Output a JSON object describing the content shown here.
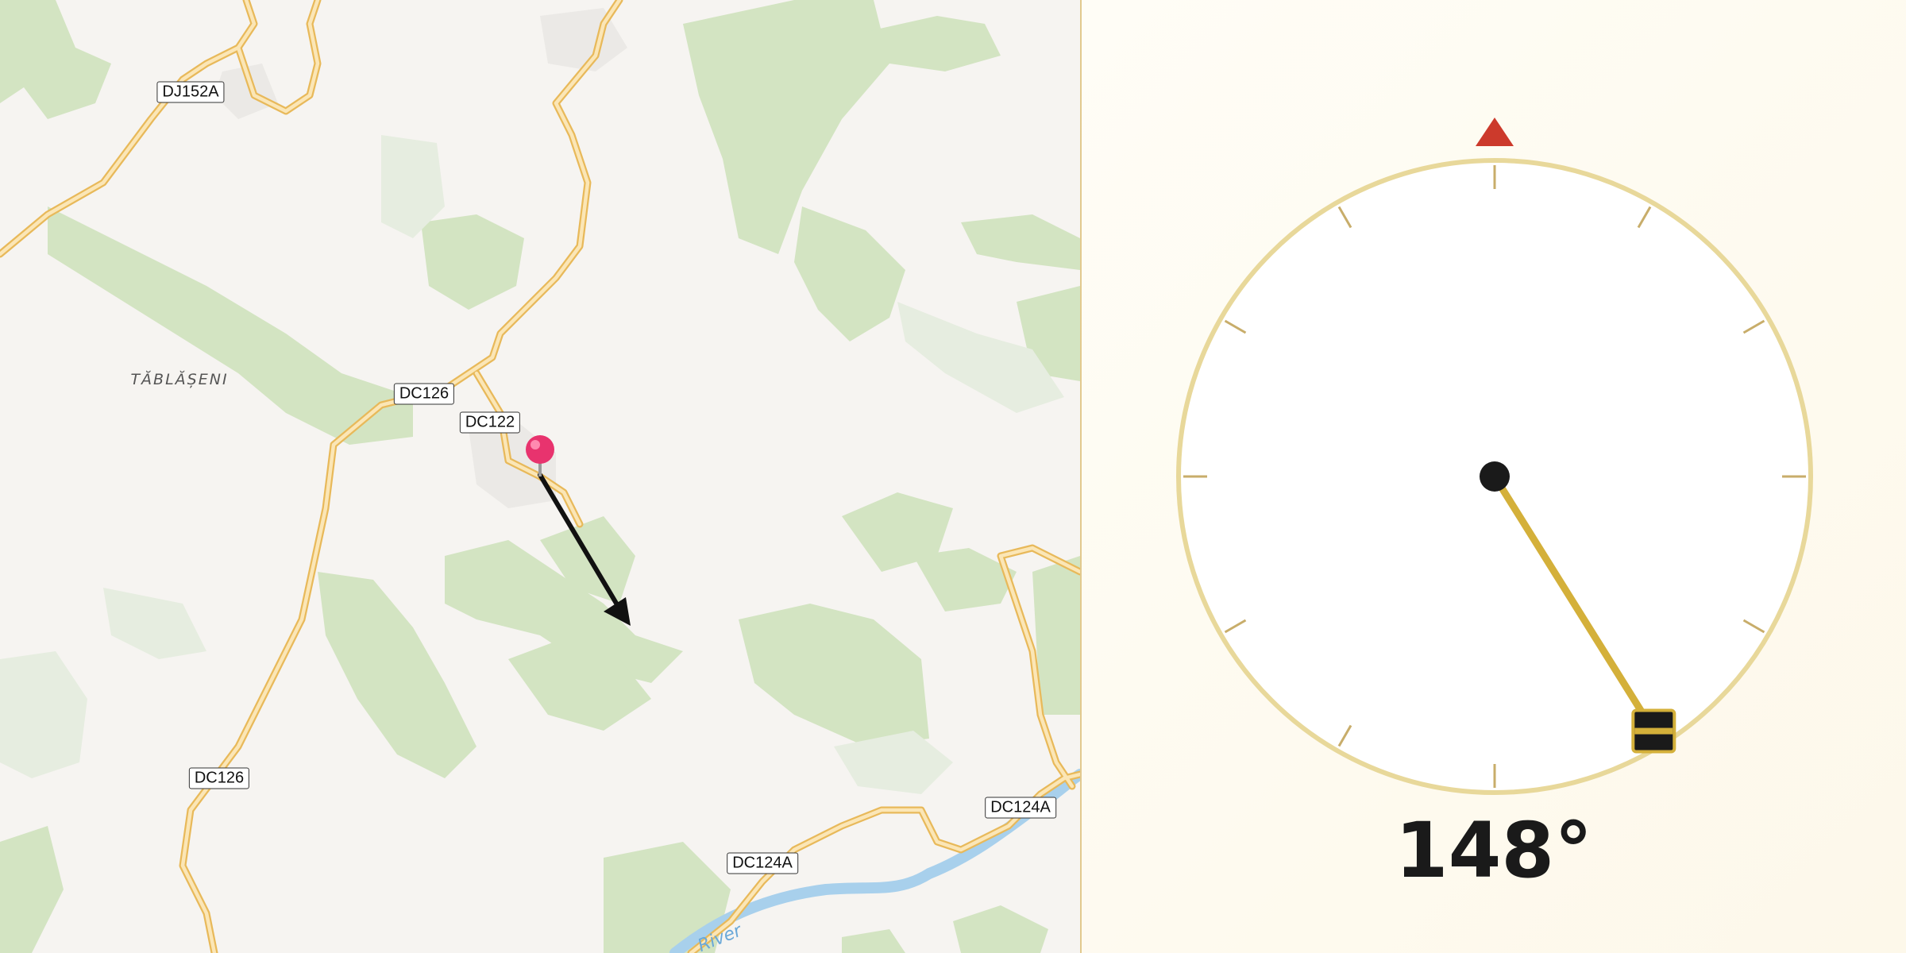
{
  "map": {
    "road_labels": [
      "DJ152A",
      "DC126",
      "DC122",
      "DC126",
      "DC124A",
      "DC124A"
    ],
    "place_labels": [
      "TĂBLĂȘENI"
    ],
    "river_label": "River",
    "marker": "map-pin"
  },
  "compass": {
    "heading_deg": 148,
    "heading_label": "148°",
    "north_marker": "north-triangle-icon"
  },
  "colors": {
    "map_background": "#f6f4f1",
    "forest": "#d3e4c2",
    "road_outline": "#e8b95a",
    "road_fill": "#fbe6b6",
    "river": "#a8d0ec",
    "pin": "#e8336e",
    "arrow": "#111111",
    "dial_ring": "#e8d89a",
    "dial_tick": "#c8ad6a",
    "needle": "#d4b03a",
    "north": "#cc3a2c"
  }
}
